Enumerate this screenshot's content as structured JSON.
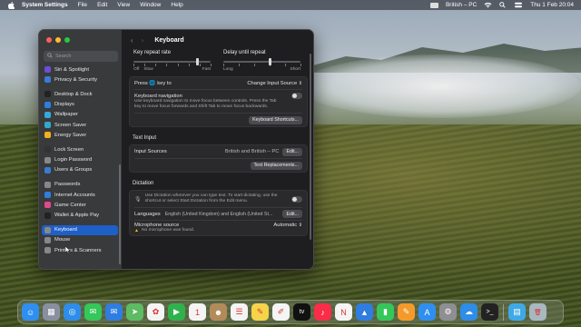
{
  "menubar": {
    "app": "System Settings",
    "items": [
      "File",
      "Edit",
      "View",
      "Window",
      "Help"
    ],
    "input_source": "British – PC",
    "datetime": "Thu 1 Feb  20:04"
  },
  "sidebar": {
    "search_placeholder": "Search",
    "items": [
      {
        "label": "Siri & Spotlight",
        "color": "#6a4fd8",
        "icon": "siri-icon"
      },
      {
        "label": "Privacy & Security",
        "color": "#3a7bd5",
        "icon": "hand-icon"
      },
      {
        "gap": true
      },
      {
        "label": "Desktop & Dock",
        "color": "#222",
        "icon": "dock-icon"
      },
      {
        "label": "Displays",
        "color": "#2f7de1",
        "icon": "display-icon"
      },
      {
        "label": "Wallpaper",
        "color": "#33aadd",
        "icon": "wallpaper-icon"
      },
      {
        "label": "Screen Saver",
        "color": "#35a8c9",
        "icon": "screensaver-icon"
      },
      {
        "label": "Energy Saver",
        "color": "#f2b01e",
        "icon": "battery-icon"
      },
      {
        "gap": true
      },
      {
        "label": "Lock Screen",
        "color": "#333",
        "icon": "lock-icon"
      },
      {
        "label": "Login Password",
        "color": "#888",
        "icon": "key-icon"
      },
      {
        "label": "Users & Groups",
        "color": "#3a7bd5",
        "icon": "users-icon"
      },
      {
        "gap": true
      },
      {
        "label": "Passwords",
        "color": "#888",
        "icon": "password-key-icon"
      },
      {
        "label": "Internet Accounts",
        "color": "#2f7de1",
        "icon": "at-icon"
      },
      {
        "label": "Game Center",
        "color": "#e04a8a",
        "icon": "game-center-icon"
      },
      {
        "label": "Wallet & Apple Pay",
        "color": "#222",
        "icon": "wallet-icon"
      },
      {
        "gap": true
      },
      {
        "label": "Keyboard",
        "color": "#888",
        "icon": "keyboard-icon",
        "selected": true
      },
      {
        "label": "Mouse",
        "color": "#888",
        "icon": "mouse-icon"
      },
      {
        "label": "Printers & Scanners",
        "color": "#888",
        "icon": "printer-icon"
      }
    ]
  },
  "main": {
    "title": "Keyboard",
    "key_repeat": {
      "label": "Key repeat rate",
      "min": "Off",
      "slow": "Slow",
      "max": "Fast",
      "level": 0.83
    },
    "delay": {
      "label": "Delay until repeat",
      "min": "Long",
      "max": "Short",
      "level": 0.6
    },
    "press_key": {
      "label": "Press 🌐 key to",
      "value": "Change Input Source"
    },
    "kbnav": {
      "label": "Keyboard navigation",
      "desc": "Use keyboard navigation to move focus between controls. Press the Tab key to move focus forwards and Shift Tab to move focus backwards."
    },
    "shortcuts_btn": "Keyboard Shortcuts...",
    "text_input": {
      "heading": "Text Input",
      "label": "Input Sources",
      "value": "British and British – PC",
      "edit": "Edit..."
    },
    "replacements_btn": "Text Replacements...",
    "dictation": {
      "heading": "Dictation",
      "desc": "Use Dictation wherever you can type text. To start dictating, use the shortcut or select Start Dictation from the Edit menu.",
      "languages_label": "Languages",
      "languages_value": "English (United Kingdom) and English (United St...",
      "edit": "Edit...",
      "mic_label": "Microphone source",
      "mic_value": "Automatic",
      "mic_warning": "No microphone was found."
    }
  },
  "dock": {
    "apps": [
      {
        "name": "finder-icon",
        "color": "#2f8ff0",
        "glyph": "☺"
      },
      {
        "name": "launchpad-icon",
        "color": "#8a8fa0",
        "glyph": "▦"
      },
      {
        "name": "safari-icon",
        "color": "#2d8de8",
        "glyph": "◎"
      },
      {
        "name": "messages-icon",
        "color": "#34c759",
        "glyph": "✉"
      },
      {
        "name": "mail-icon",
        "color": "#2f7de1",
        "glyph": "✉"
      },
      {
        "name": "maps-icon",
        "color": "#5dbb63",
        "glyph": "➤"
      },
      {
        "name": "photos-icon",
        "color": "#f4f4f4",
        "glyph": "✿"
      },
      {
        "name": "facetime-icon",
        "color": "#2fb24c",
        "glyph": "▶"
      },
      {
        "name": "calendar-icon",
        "color": "#f4f4f4",
        "glyph": "1"
      },
      {
        "name": "contacts-icon",
        "color": "#b38a5a",
        "glyph": "☻"
      },
      {
        "name": "reminders-icon",
        "color": "#f4f4f4",
        "glyph": "☰"
      },
      {
        "name": "notes-icon",
        "color": "#f5d44a",
        "glyph": "✎"
      },
      {
        "name": "freeform-icon",
        "color": "#f4f4f4",
        "glyph": "✐"
      },
      {
        "name": "tv-icon",
        "color": "#111",
        "glyph": "tv"
      },
      {
        "name": "music-icon",
        "color": "#fa2d48",
        "glyph": "♪"
      },
      {
        "name": "news-icon",
        "color": "#f4f4f4",
        "glyph": "N"
      },
      {
        "name": "keynote-icon",
        "color": "#2f7de1",
        "glyph": "▲"
      },
      {
        "name": "numbers-icon",
        "color": "#34c759",
        "glyph": "▮"
      },
      {
        "name": "pages-icon",
        "color": "#f59a2a",
        "glyph": "✎"
      },
      {
        "name": "app-store-icon",
        "color": "#2f8ff0",
        "glyph": "A"
      },
      {
        "name": "system-settings-icon",
        "color": "#8e8e93",
        "glyph": "⚙"
      },
      {
        "name": "iphone-mirroring-icon",
        "color": "#2d8de8",
        "glyph": "☁"
      },
      {
        "name": "terminal-icon",
        "color": "#222",
        "glyph": ">_"
      },
      {
        "sep": true
      },
      {
        "name": "downloads-folder-icon",
        "color": "#3fa9e6",
        "glyph": "▤"
      },
      {
        "name": "trash-icon",
        "color": "#a8b8c0",
        "glyph": "🗑"
      }
    ]
  }
}
